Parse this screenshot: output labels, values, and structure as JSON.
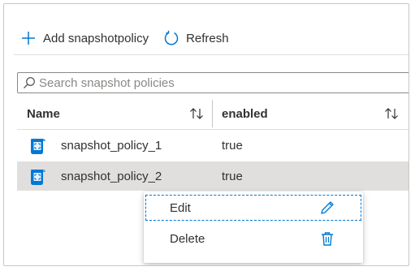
{
  "toolbar": {
    "add_label": "Add snapshotpolicy",
    "refresh_label": "Refresh"
  },
  "search": {
    "placeholder": "Search snapshot policies",
    "value": ""
  },
  "table": {
    "columns": [
      "Name",
      "enabled"
    ],
    "rows": [
      {
        "name": "snapshot_policy_1",
        "enabled": "true"
      },
      {
        "name": "snapshot_policy_2",
        "enabled": "true"
      }
    ]
  },
  "context_menu": {
    "items": [
      {
        "label": "Edit",
        "icon": "pencil-icon"
      },
      {
        "label": "Delete",
        "icon": "trash-icon"
      }
    ]
  },
  "colors": {
    "accent": "#0078d4",
    "selected_row": "#e1dfdd"
  }
}
